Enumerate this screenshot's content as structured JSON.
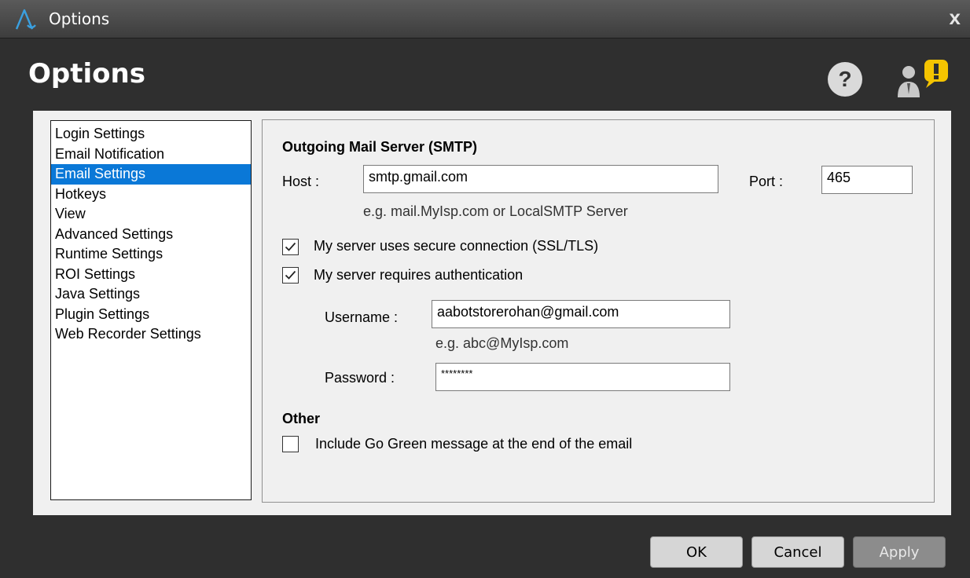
{
  "window": {
    "title": "Options",
    "close_glyph": "x"
  },
  "header": {
    "title": "Options",
    "help_glyph": "?",
    "help_icon": "help-icon",
    "alert_icon": "user-alert-icon"
  },
  "sidebar": {
    "selected_index": 2,
    "items": [
      {
        "label": "Login Settings"
      },
      {
        "label": "Email Notification"
      },
      {
        "label": "Email Settings"
      },
      {
        "label": "Hotkeys"
      },
      {
        "label": "View"
      },
      {
        "label": "Advanced Settings"
      },
      {
        "label": "Runtime Settings"
      },
      {
        "label": "ROI Settings"
      },
      {
        "label": "Java Settings"
      },
      {
        "label": "Plugin Settings"
      },
      {
        "label": "Web Recorder Settings"
      }
    ]
  },
  "smtp": {
    "section_title": "Outgoing Mail Server (SMTP)",
    "host_label": "Host :",
    "host_value": "smtp.gmail.com",
    "host_hint": "e.g. mail.MyIsp.com or LocalSMTP Server",
    "port_label": "Port :",
    "port_value": "465",
    "ssl_label": "My server uses secure connection (SSL/TLS)",
    "ssl_checked": true,
    "auth_label": "My server requires authentication",
    "auth_checked": true,
    "username_label": "Username :",
    "username_value": "aabotstorerohan@gmail.com",
    "username_hint": "e.g. abc@MyIsp.com",
    "password_label": "Password :",
    "password_value": "********"
  },
  "other": {
    "section_title": "Other",
    "go_green_label": "Include Go Green message at the end of the email",
    "go_green_checked": false
  },
  "buttons": {
    "ok": "OK",
    "cancel": "Cancel",
    "apply": "Apply"
  },
  "colors": {
    "selection": "#0a78d7",
    "alert_yellow": "#f5c400",
    "title_bar": "#4a4a4a",
    "logo_blue": "#3aa0e0"
  }
}
